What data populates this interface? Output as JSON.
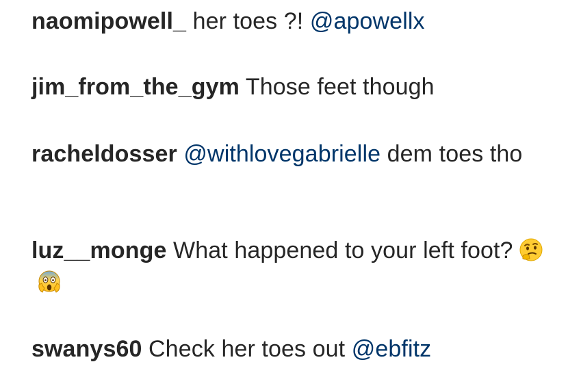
{
  "comments": [
    {
      "username": "naomipowell_",
      "text": "her toes ?!",
      "mention": "@apowellx"
    },
    {
      "username": "jim_from_the_gym",
      "text": "Those feet though"
    },
    {
      "username": "racheldosser",
      "mention": "@withlovegabrielle",
      "text": "dem toes tho"
    },
    {
      "username": "luz__monge",
      "text": "What happened to your left foot?",
      "emojis": [
        "thinking-face-icon",
        "face-screaming-in-fear-icon"
      ]
    },
    {
      "username": "swanys60",
      "text": "Check her toes out",
      "mention": "@ebfitz"
    }
  ],
  "colors": {
    "text": "#262626",
    "mention": "#003569",
    "background": "#ffffff"
  }
}
